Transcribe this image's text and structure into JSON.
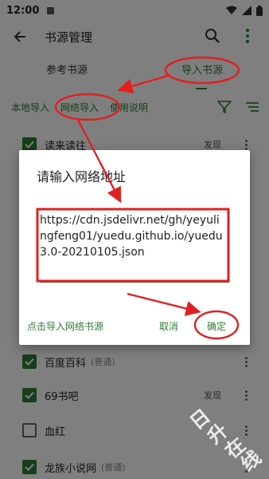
{
  "status_bar": {
    "time": "12:00"
  },
  "toolbar": {
    "title": "书源管理"
  },
  "tabs": [
    {
      "label": "参考书源"
    },
    {
      "label": "导入书源"
    }
  ],
  "actions": {
    "local_import": "本地导入",
    "network_import": "网络导入",
    "usage": "使用说明"
  },
  "list": [
    {
      "name": "读来读往",
      "tag": "",
      "discover": "发现",
      "checked": true
    },
    {
      "name": "百度百科",
      "tag": "(普通)",
      "discover": "",
      "checked": true
    },
    {
      "name": "69书吧",
      "tag": "",
      "discover": "发现",
      "checked": true
    },
    {
      "name": "血红",
      "tag": "",
      "discover": "",
      "checked": false
    },
    {
      "name": "龙族小说网",
      "tag": "(普通)",
      "discover": "",
      "checked": true
    }
  ],
  "dialog": {
    "title": "请输入网络地址",
    "input_value": "https://cdn.jsdelivr.net/gh/yeyulingfeng01/yuedu.github.io/yuedu3.0-20210105.json",
    "web_sources_button": "点击导入网络书源",
    "cancel_button": "取消",
    "ok_button": "确定"
  },
  "colors": {
    "accent": "#2e7d32",
    "annotation": "#e02020"
  },
  "watermark": "日升在线"
}
